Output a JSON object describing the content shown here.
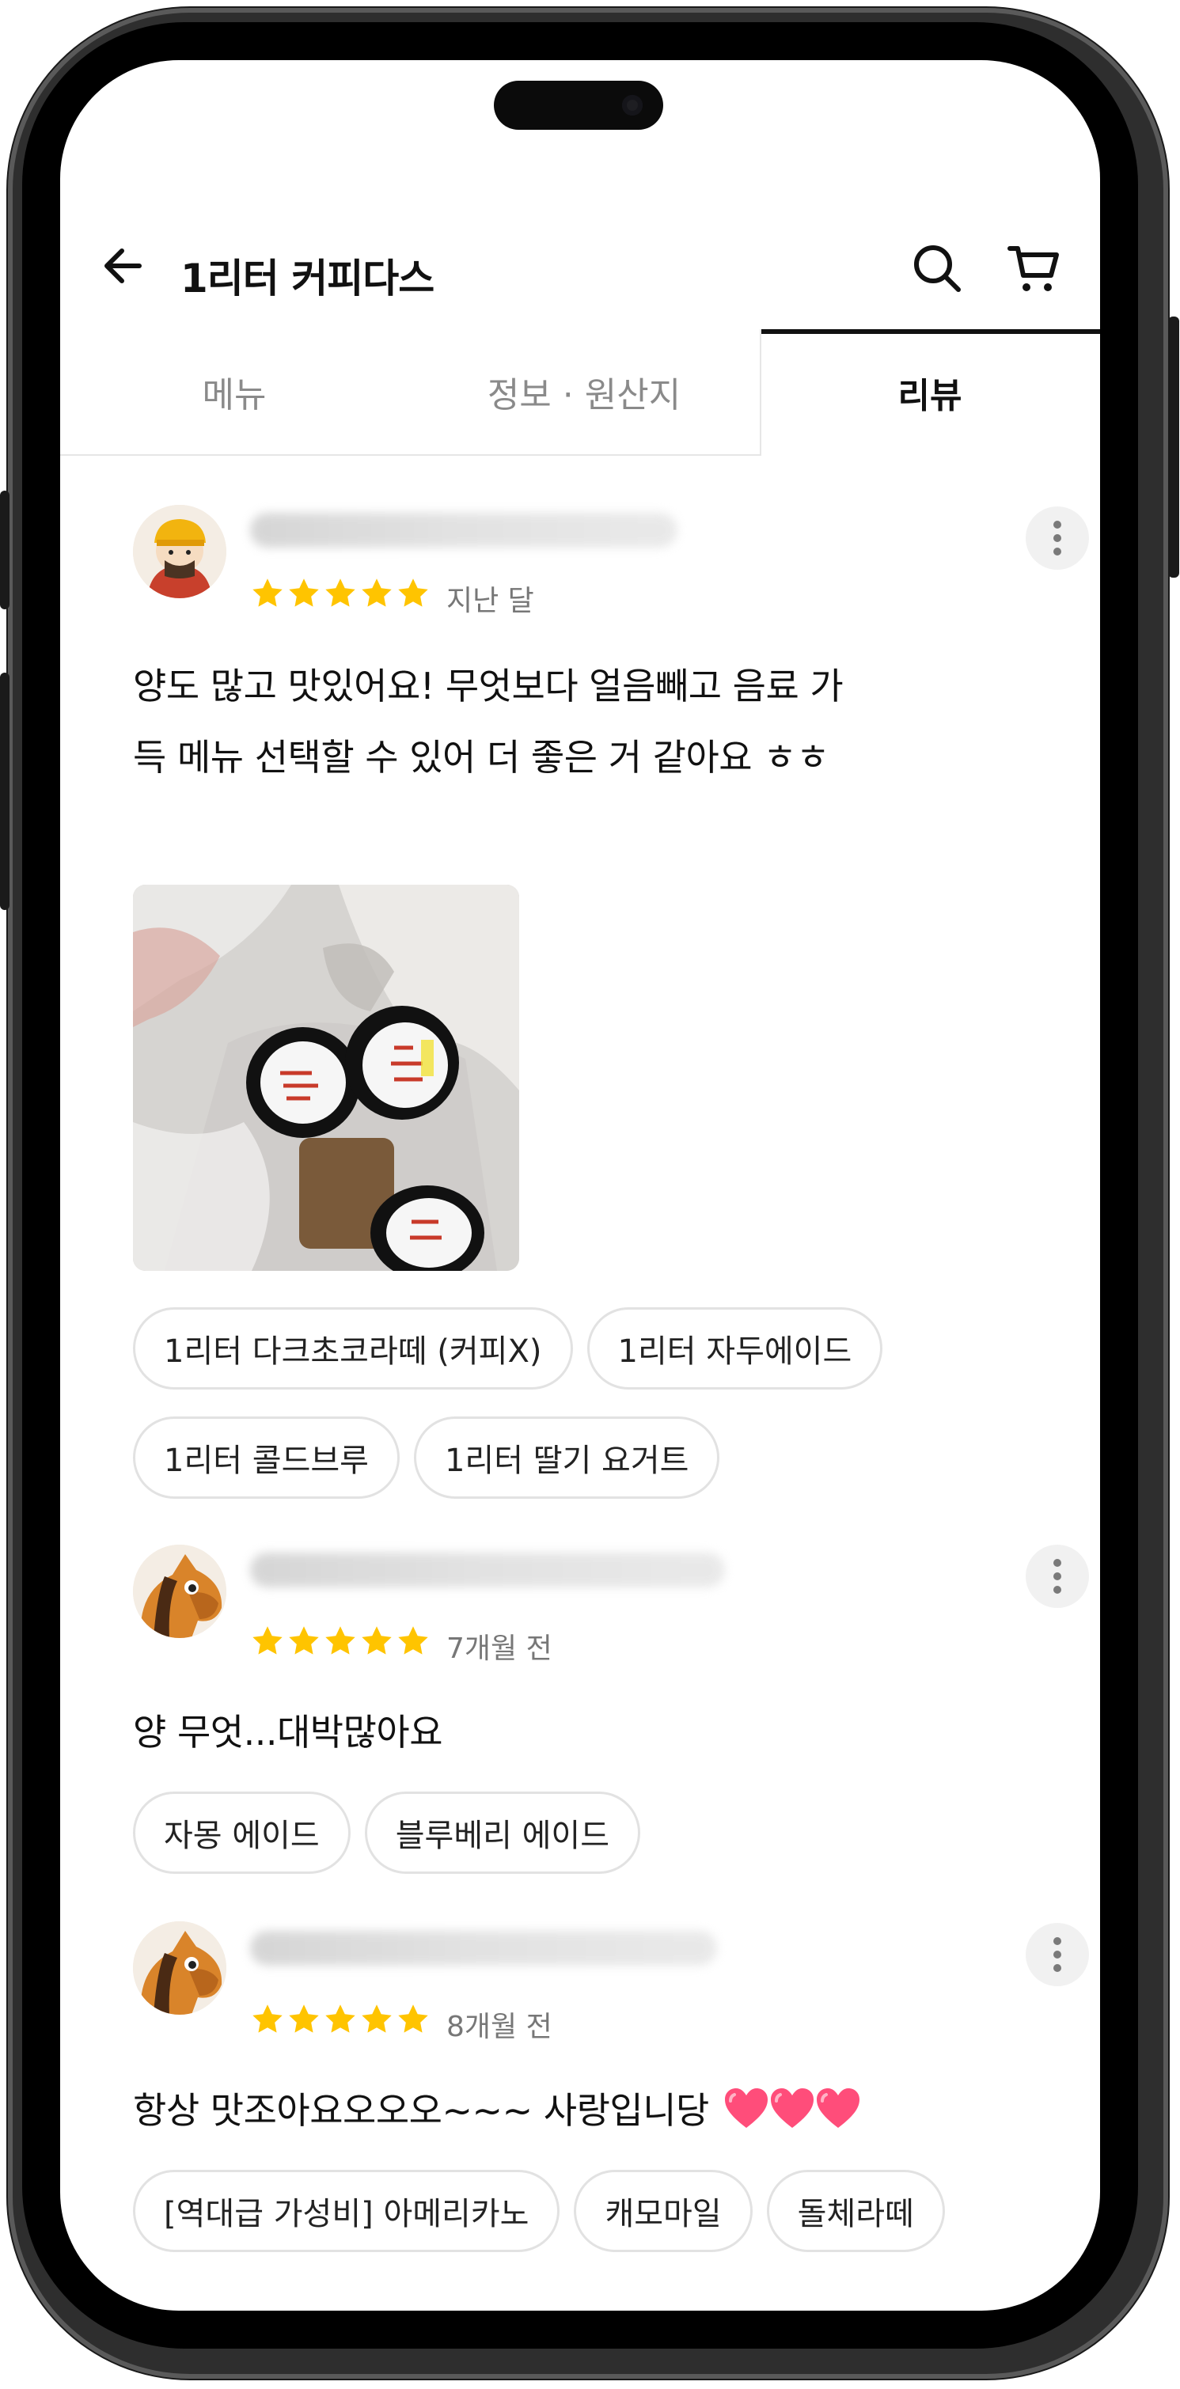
{
  "store": {
    "title": "1리터 커피다스"
  },
  "tabs": [
    {
      "label": "메뉴"
    },
    {
      "label": "정보 · 원산지"
    },
    {
      "label": "리뷰"
    }
  ],
  "icons": {
    "back": "arrow-left-icon",
    "search": "search-icon",
    "cart": "cart-icon",
    "more": "more-vertical-icon",
    "star": "star-icon"
  },
  "colors": {
    "star": "#FFC400",
    "heart": "#FF4D7A",
    "active_tab": "#111111"
  },
  "reviews": [
    {
      "rating": 5,
      "date": "지난 달",
      "text": "양도 많고 맛있어요! 무엇보다 얼음빼고 음료 가득 메뉴 선택할 수 있어 더 좋은 거 같아요 ㅎㅎ",
      "has_photo": true,
      "menus": [
        "1리터 다크초코라떼 (커피X)",
        "1리터 자두에이드",
        "1리터 콜드브루",
        "1리터 딸기 요거트"
      ]
    },
    {
      "rating": 5,
      "date": "7개월 전",
      "text": "양 무엇...대박많아요",
      "menus": [
        "자몽 에이드",
        "블루베리 에이드"
      ]
    },
    {
      "rating": 5,
      "date": "8개월 전",
      "text": "항상 맛조아요오오오~~~ 사랑입니당",
      "menus": [
        "[역대급 가성비] 아메리카노",
        "캐모마일",
        "돌체라떼"
      ]
    }
  ]
}
